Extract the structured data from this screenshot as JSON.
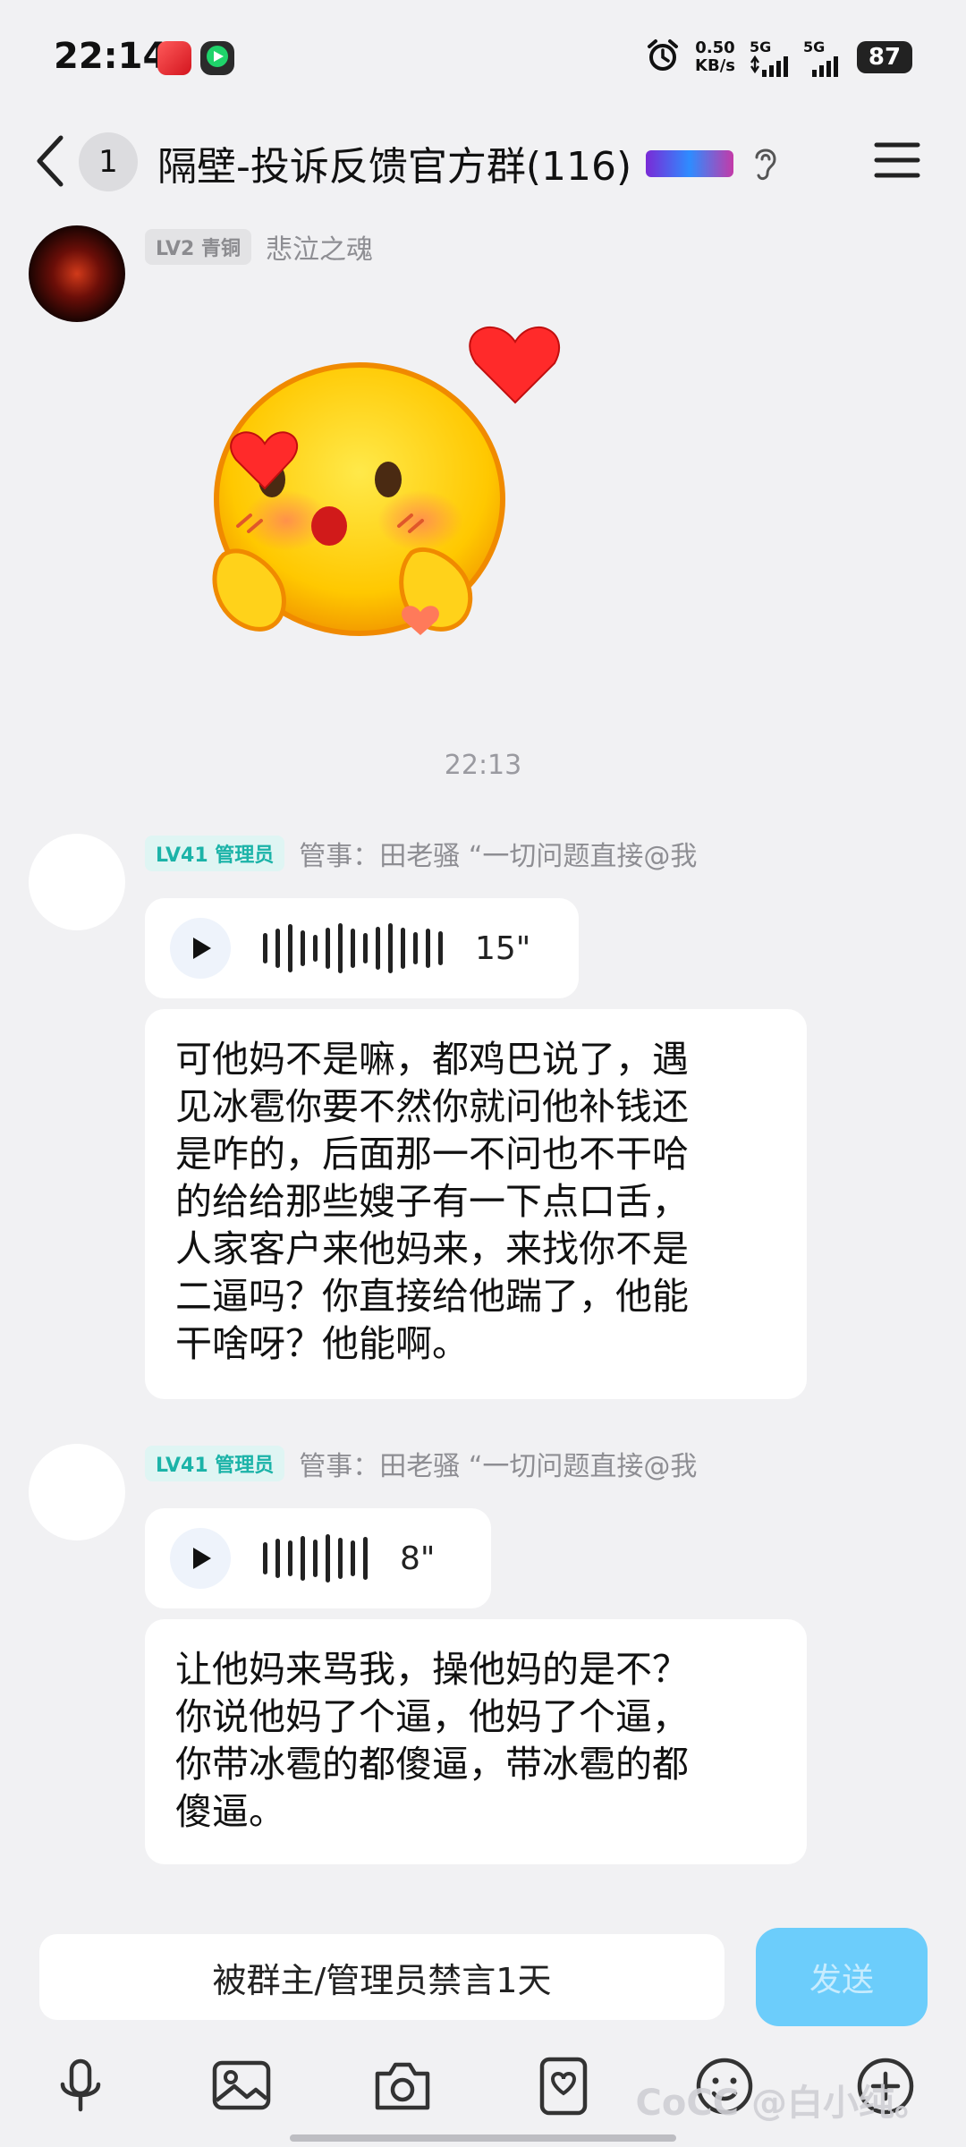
{
  "status_bar": {
    "time": "22:14",
    "net_speed_value": "0.50",
    "net_speed_unit": "KB/s",
    "sim1_label": "5G",
    "sim2_label": "5G",
    "battery": "87",
    "app_icons": [
      "red-app-icon",
      "green-video-app-icon"
    ],
    "alarm_icon": "alarm-icon"
  },
  "header": {
    "unread_count": "1",
    "title": "隔壁-投诉反馈官方群(116)"
  },
  "messages": [
    {
      "level_badge": "LV2 青铜",
      "sender": "悲泣之魂",
      "type": "sticker",
      "sticker": "blushing-heart-emoji-sticker"
    },
    {
      "type": "time",
      "text": "22:13"
    },
    {
      "level_badge": "LV41 管理员",
      "sender": "管事：田老骚 “一切问题直接@我",
      "type": "voice",
      "duration": "15\"",
      "text": "可他妈不是嘛，都鸡巴说了，遇\n见冰雹你要不然你就问他补钱还\n是咋的，后面那一不问也不干哈\n的给给那些嫂子有一下点口舌，\n人家客户来他妈来，来找你不是\n二逼吗？你直接给他踹了，他能\n干啥呀？他能啊。"
    },
    {
      "level_badge": "LV41 管理员",
      "sender": "管事：田老骚 “一切问题直接@我",
      "type": "voice",
      "duration": "8\"",
      "text": "让他妈来骂我，操他妈的是不？\n你说他妈了个逼，他妈了个逼，\n你带冰雹的都傻逼，带冰雹的都\n傻逼。"
    }
  ],
  "input": {
    "muted_text": "被群主/管理员禁言1天",
    "send_label": "发送"
  },
  "toolbar": [
    "microphone-icon",
    "image-icon",
    "camera-icon",
    "sticker-pack-icon",
    "emoji-icon",
    "plus-icon"
  ],
  "watermark": "CoCC @白小纯。",
  "colors": {
    "background": "#f1f1f3",
    "admin_badge": "#1bb3a8",
    "send_button": "#6ccdfb"
  }
}
